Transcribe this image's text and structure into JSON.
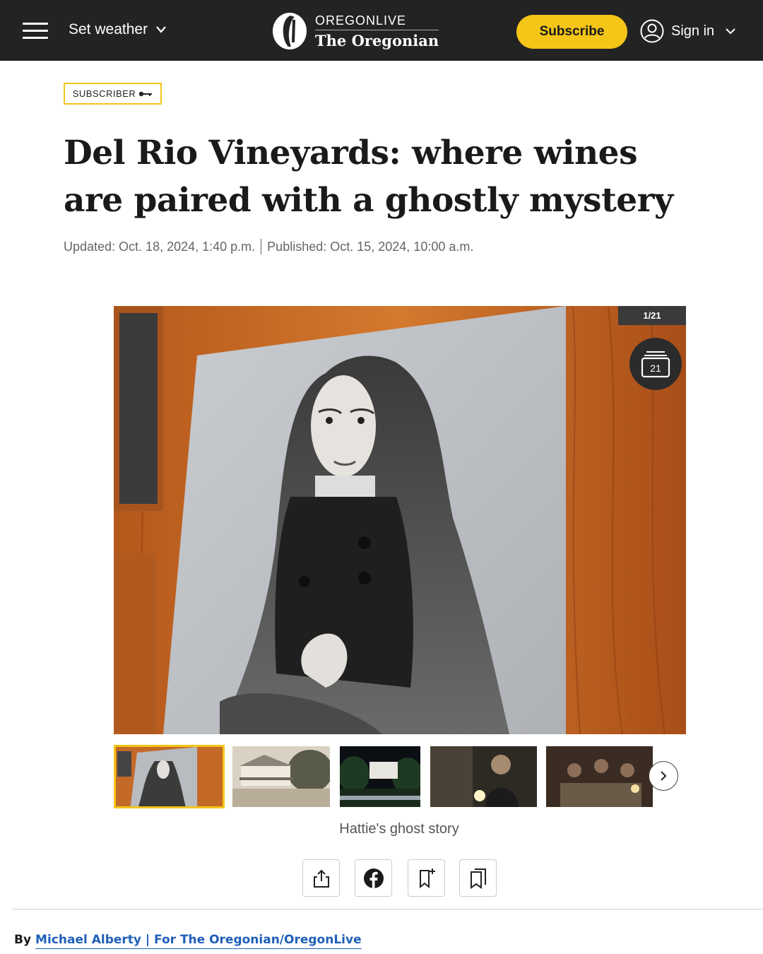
{
  "header": {
    "weather_label": "Set weather",
    "logo_top": "OREGONLIVE",
    "logo_bottom": "The Oregonian",
    "subscribe_label": "Subscribe",
    "signin_label": "Sign in"
  },
  "article": {
    "badge": "SUBSCRIBER",
    "headline": "Del Rio Vineyards: where wines are paired with a ghostly mystery",
    "updated": "Updated: Oct. 18, 2024, 1:40 p.m.",
    "published": "Published: Oct. 15, 2024, 10:00 a.m."
  },
  "gallery": {
    "counter": "1/21",
    "stack_count": "21",
    "caption": "Hattie's ghost story",
    "thumbnails": [
      "portrait",
      "farmhouse",
      "house-at-night",
      "man-with-lantern",
      "group-at-table"
    ]
  },
  "share": {
    "icons": [
      "share-icon",
      "facebook-icon",
      "bookmark-add-icon",
      "bookmarks-icon"
    ]
  },
  "byline": {
    "prefix": "By",
    "author": "Michael Alberty | For The Oregonian/OregonLive"
  },
  "colors": {
    "header_bg": "#232323",
    "accent_yellow": "#f5c518",
    "link_blue": "#1f5fb8"
  }
}
